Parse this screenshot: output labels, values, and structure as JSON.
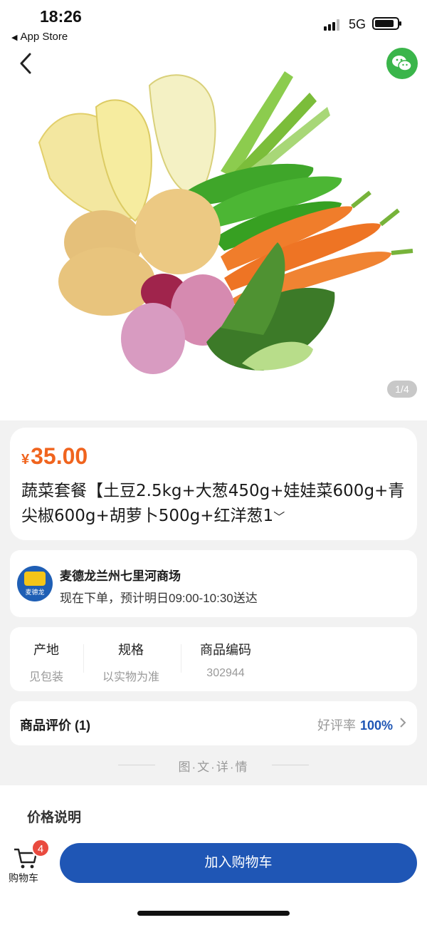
{
  "status_bar": {
    "time": "18:26",
    "back_label": "App Store",
    "network": "5G"
  },
  "hero": {
    "pager": "1/4"
  },
  "product": {
    "currency": "¥",
    "price": "35.00",
    "title": "蔬菜套餐【土豆2.5kg+大葱450g+娃娃菜600g+青尖椒600g+胡萝卜500g+红洋葱1"
  },
  "store": {
    "logo_text": "麦德龙",
    "name": "麦德龙兰州七里河商场",
    "eta": "现在下单，预计明日09:00-10:30送达"
  },
  "specs": [
    {
      "key": "产地",
      "value": "见包装"
    },
    {
      "key": "规格",
      "value": "以实物为准"
    },
    {
      "key": "商品编码",
      "value": "302944"
    }
  ],
  "review": {
    "title": "商品评价 (1)",
    "rate_label": "好评率",
    "rate_value": "100%"
  },
  "detail_section": {
    "title": "图·文·详·情"
  },
  "price_explain": {
    "title": "价格说明"
  },
  "bottom_bar": {
    "cart_count": "4",
    "cart_label": "购物车",
    "add_to_cart": "加入购物车"
  },
  "colors": {
    "price": "#f0641e",
    "primary": "#1f56b5",
    "badge": "#e94a3f",
    "share": "#3ab54a"
  }
}
